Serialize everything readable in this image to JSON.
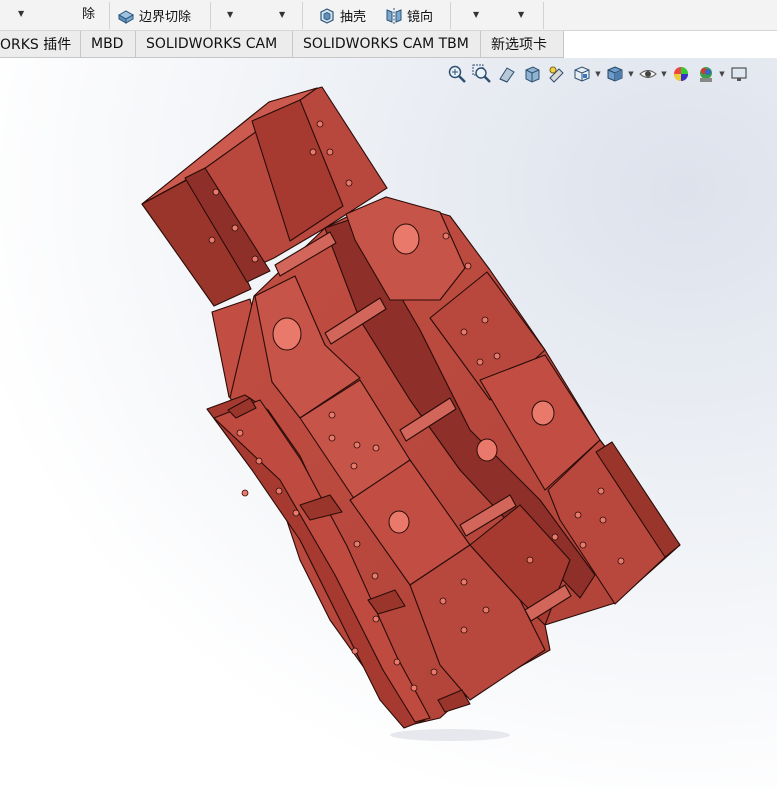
{
  "command_manager": {
    "delete_fragment": "除",
    "boundary_cut_label": "边界切除",
    "shell_label": "抽壳",
    "mirror_label": "镜向"
  },
  "tabs": [
    {
      "label": "ORKS 插件"
    },
    {
      "label": "MBD"
    },
    {
      "label": "SOLIDWORKS CAM"
    },
    {
      "label": "SOLIDWORKS CAM TBM"
    },
    {
      "label": "新选项卡"
    }
  ],
  "view_toolbar": {
    "icons": [
      "zoom-to-fit-icon",
      "zoom-to-area-icon",
      "previous-view-icon",
      "section-view-icon",
      "dynamic-annotation-icon",
      "view-orientation-icon",
      "display-style-icon",
      "hide-show-items-icon",
      "edit-appearance-icon",
      "apply-scene-icon",
      "view-settings-icon"
    ]
  },
  "colors": {
    "part_face": "#b8473d",
    "part_face_light": "#cc5a4e",
    "part_face_dark": "#8e3029",
    "edge": "#2a0c08",
    "toolbar_bg": "#f3f3f3"
  }
}
